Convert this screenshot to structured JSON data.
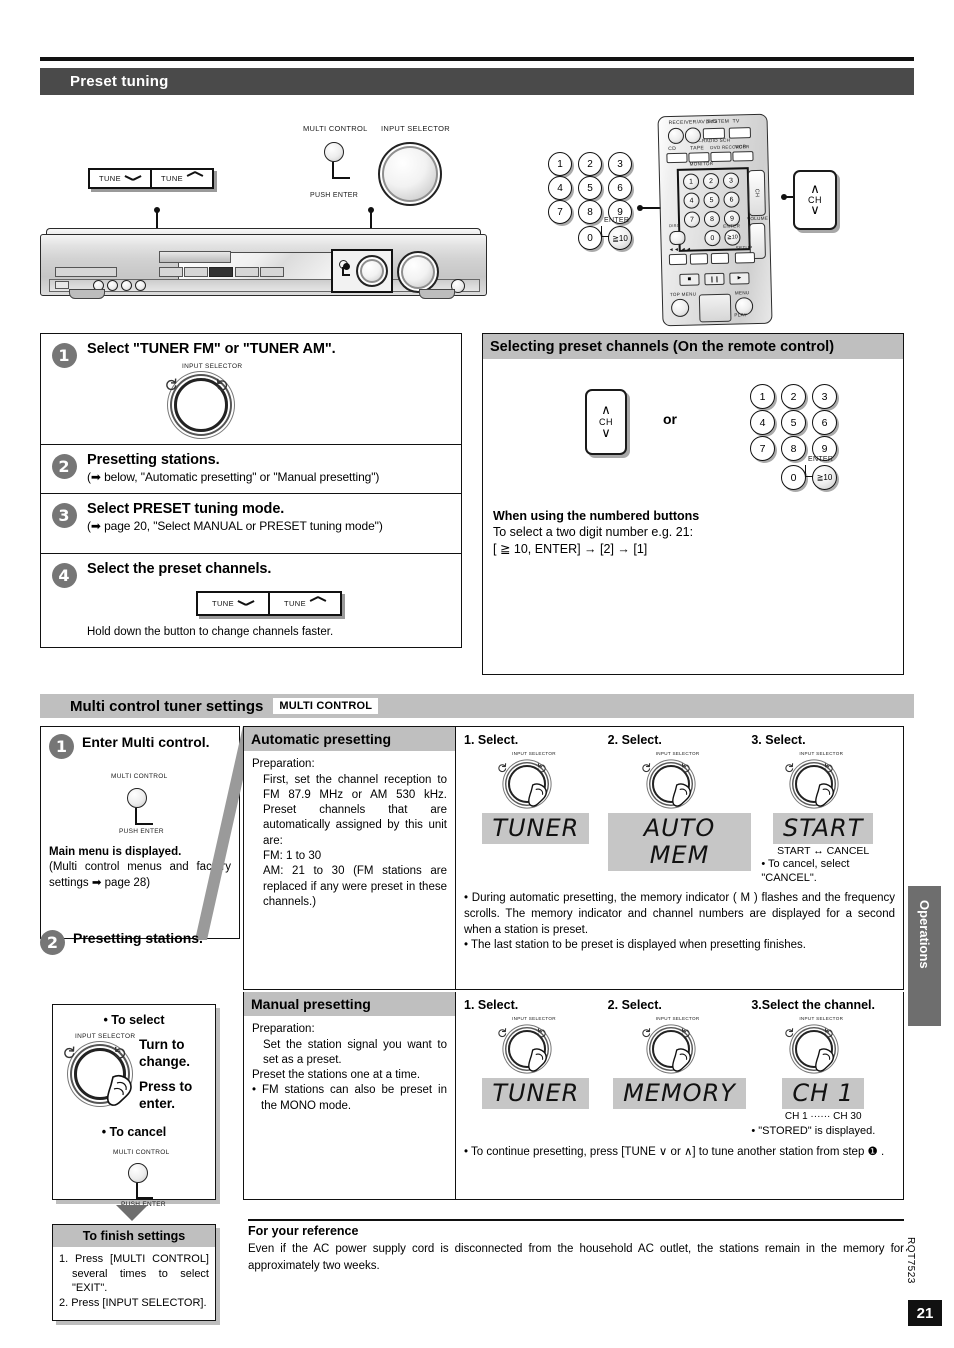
{
  "page": {
    "section_title": "Preset tuning",
    "page_number": "21",
    "doc_code": "RQT7523",
    "side_tab": "Operations"
  },
  "top_illustration": {
    "tune_down_label": "TUNE",
    "tune_up_label": "TUNE",
    "multi_control_label": "MULTI CONTROL",
    "push_enter_label": "PUSH ENTER",
    "input_selector_label": "INPUT SELECTOR",
    "ch_label": "CH",
    "keypad": [
      "1",
      "2",
      "3",
      "4",
      "5",
      "6",
      "7",
      "8",
      "9",
      "0",
      "≧10"
    ],
    "enter_label": "ENTER",
    "remote_keys_row1": [
      "DVD",
      "TV"
    ],
    "remote_keys_row2": [
      "CD",
      "TAPE",
      "DVD RECORDER",
      "VCR"
    ],
    "remote_receiver_label": "RECEIVER/AV SYSTEM",
    "remote_monitor_label": "MONITOR",
    "remote_volume_label": "VOLUME",
    "remote_disc_label": "DISC",
    "remote_setup_label": "SETUP",
    "remote_topmenu_label": "TOP MENU",
    "remote_menu_label": "MENU",
    "remote_play_label": "PLAY"
  },
  "steps": [
    {
      "num": "1",
      "title": "Select \"TUNER FM\" or \"TUNER AM\".",
      "sub": "",
      "dial_label": "INPUT SELECTOR"
    },
    {
      "num": "2",
      "title": "Presetting stations.",
      "sub": "(➡ below, \"Automatic presetting\" or \"Manual presetting\")"
    },
    {
      "num": "3",
      "title": "Select PRESET tuning mode.",
      "sub": "(➡ page 20,  \"Select MANUAL or PRESET tuning mode\")"
    },
    {
      "num": "4",
      "title": "Select the preset channels.",
      "tune_down_label": "TUNE",
      "tune_up_label": "TUNE",
      "note": "Hold down the button to change channels faster."
    }
  ],
  "preset_box": {
    "header": "Selecting preset channels (On the remote control)",
    "ch_label": "CH",
    "or_label": "or",
    "keypad": [
      "1",
      "2",
      "3",
      "4",
      "5",
      "6",
      "7",
      "8",
      "9",
      "0",
      "≧10"
    ],
    "enter_label": "ENTER",
    "note_title": "When using the numbered buttons",
    "note_line1": "To select a two digit number e.g. 21:",
    "note_line2": "[ ≧ 10, ENTER] → [2] → [1]"
  },
  "multi_control": {
    "header_title": "Multi control tuner settings",
    "header_badge": "MULTI CONTROL",
    "step1": {
      "num": "1",
      "title": "Enter Multi control.",
      "multi_control_label": "MULTI CONTROL",
      "push_enter_label": "PUSH ENTER",
      "result_bold": "Main menu is displayed.",
      "result_text": "(Multi control menus and factory settings ➡ page 28)"
    },
    "step2": {
      "num": "2",
      "title": "Presetting stations.",
      "to_select": "• To select",
      "turn_to_change": "Turn to change.",
      "press_to_enter": "Press to enter.",
      "to_cancel": "• To cancel",
      "input_selector_label": "INPUT SELECTOR",
      "multi_control_label": "MULTI CONTROL",
      "push_enter_label": "PUSH ENTER"
    }
  },
  "automatic": {
    "header": "Automatic presetting",
    "prep_label": "Preparation:",
    "prep_lines": [
      "First, set the channel reception to FM 87.9 MHz or AM 530 kHz. Preset channels that are automatically assigned by this unit are:",
      "FM: 1 to 30",
      "AM: 21 to 30 (FM stations are replaced if any were preset in these channels.)"
    ],
    "columns": [
      {
        "heading": "1. Select.",
        "display": "TUNER",
        "dial_label": "INPUT SELECTOR"
      },
      {
        "heading": "2. Select.",
        "display": "AUTO MEM",
        "dial_label": "INPUT SELECTOR"
      },
      {
        "heading": "3. Select.",
        "display": "START",
        "dial_label": "INPUT SELECTOR",
        "toggle": "START ↔ CANCEL",
        "note": "• To cancel, select \"CANCEL\"."
      }
    ],
    "notes": [
      "• During automatic presetting, the memory indicator ( M ) flashes and the frequency scrolls. The memory indicator and channel numbers are displayed for a second when a station is preset.",
      "• The last station to be preset is displayed when presetting finishes."
    ],
    "memory_indicator": "M"
  },
  "manual": {
    "header": "Manual presetting",
    "prep_label": "Preparation:",
    "prep_lines": [
      "Set the station signal you want to set as a preset.",
      "Preset the stations one at a time.",
      "• FM stations can also be preset in the MONO mode."
    ],
    "columns": [
      {
        "heading": "1. Select.",
        "display": "TUNER",
        "dial_label": "INPUT SELECTOR"
      },
      {
        "heading": "2. Select.",
        "display": "MEMORY",
        "dial_label": "INPUT SELECTOR"
      },
      {
        "heading": "3.Select the channel.",
        "display": "CH   1",
        "dial_label": "INPUT SELECTOR",
        "range": "CH 1 ······ CH 30",
        "note": "• \"STORED\" is displayed."
      }
    ],
    "notes": [
      "• To continue presetting, press [TUNE ∨ or ∧] to tune another station from step ❶ ."
    ]
  },
  "finish": {
    "header": "To finish settings",
    "line1": "1. Press [MULTI CONTROL] several times to select \"EXIT\".",
    "line2": "2. Press [INPUT SELECTOR]."
  },
  "reference": {
    "header": "For your reference",
    "body": "Even if the AC power supply cord is disconnected from the household AC outlet, the stations remain in the memory for approximately two weeks."
  }
}
